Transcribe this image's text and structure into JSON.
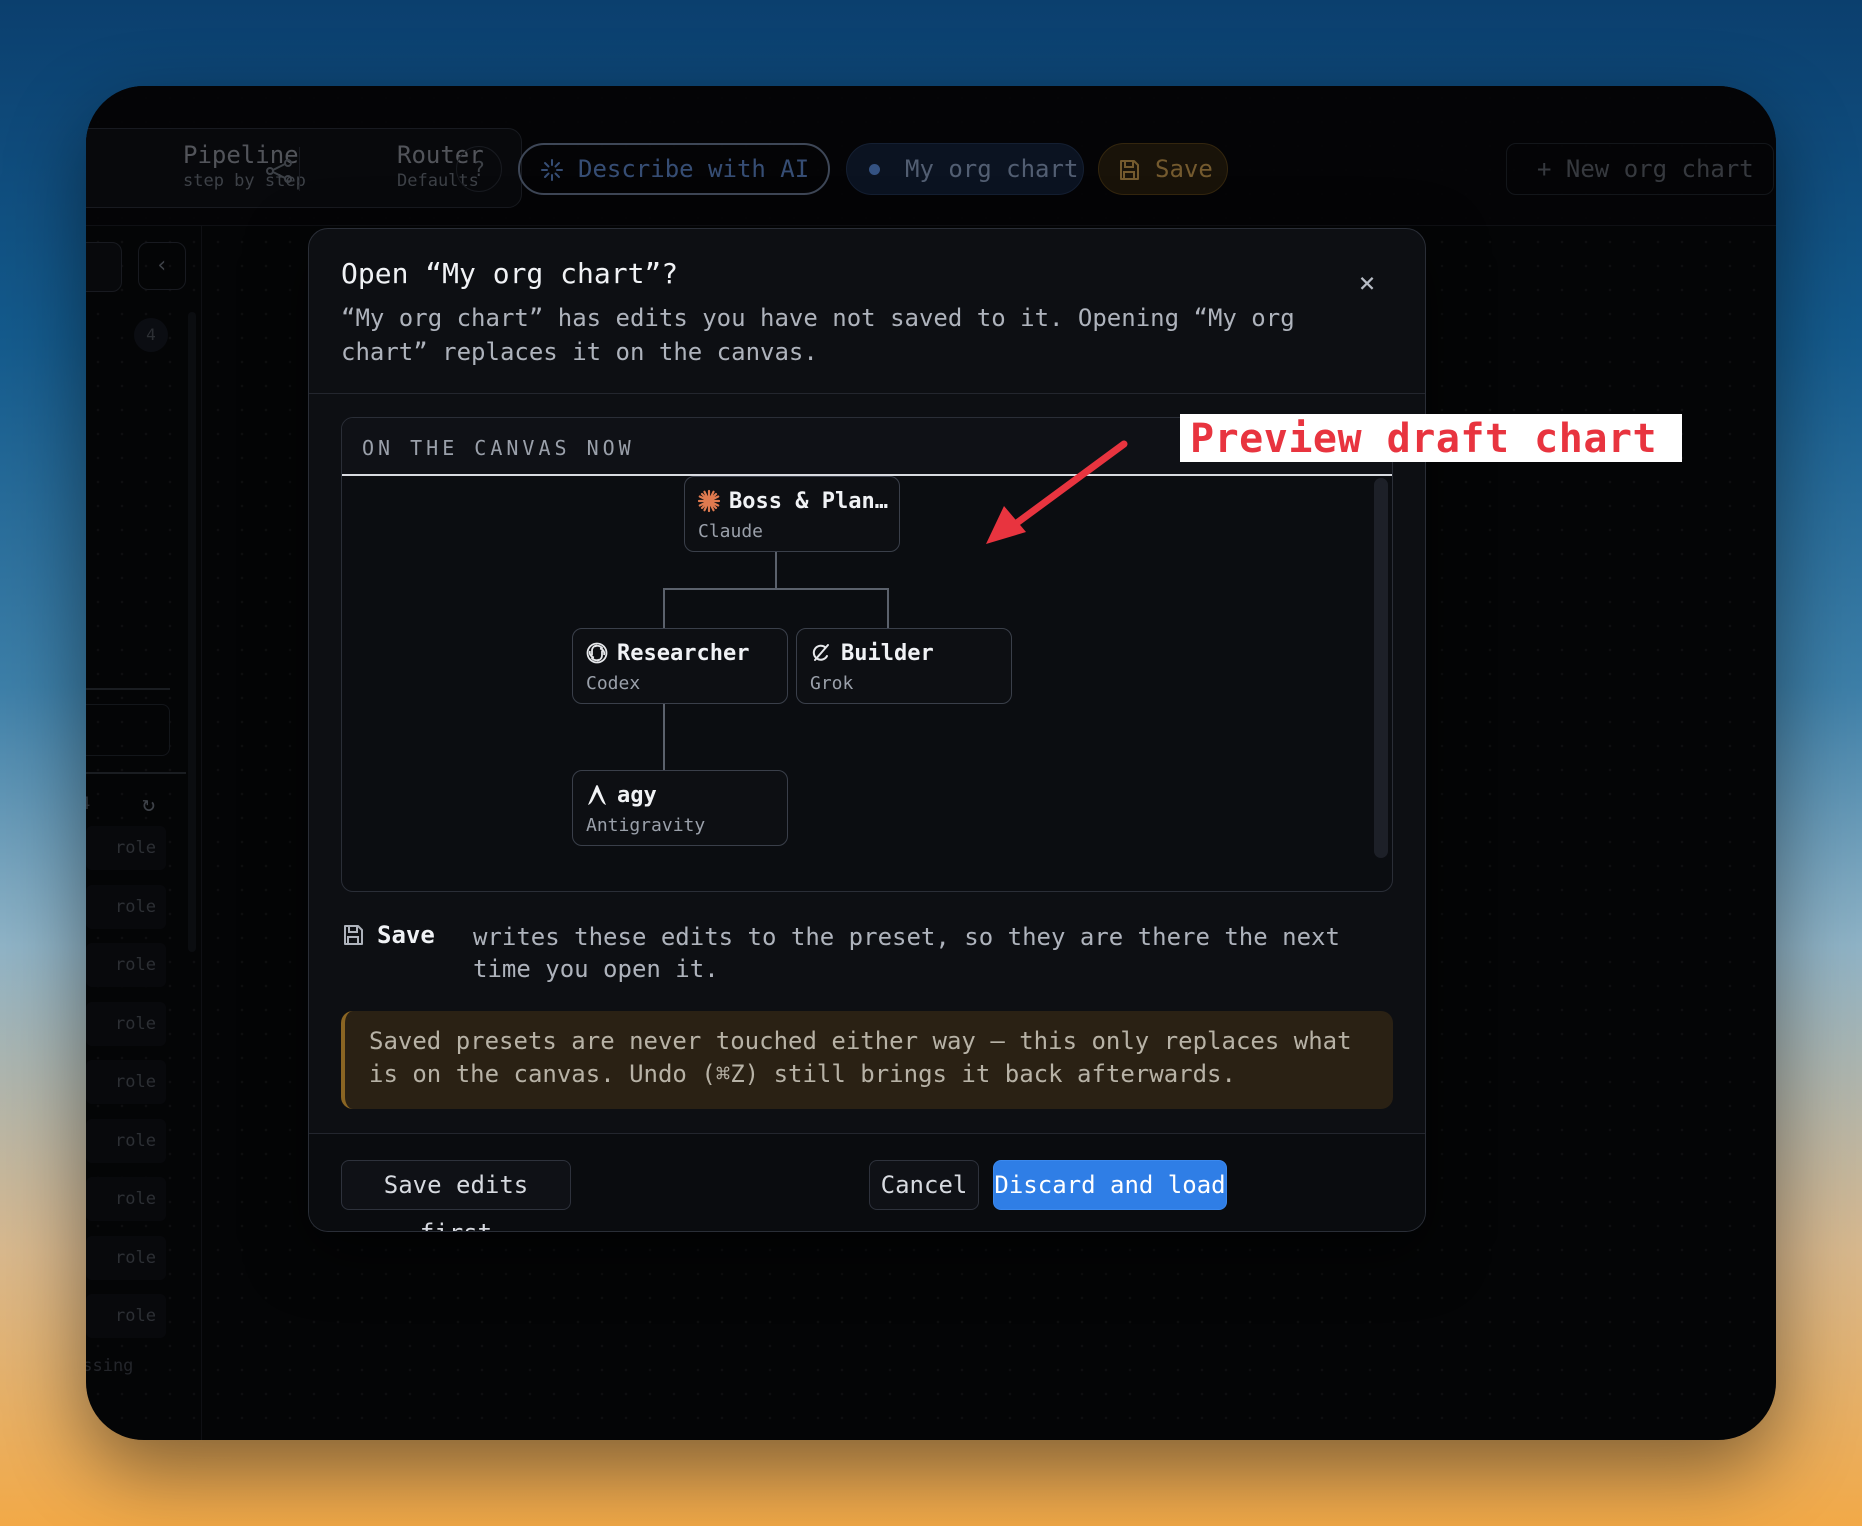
{
  "toolbar": {
    "pipeline_title": "Pipeline",
    "pipeline_sub": "step by step",
    "router_title": "Router",
    "router_sub": "Defaults",
    "help_label": "?",
    "describe_ai_label": "Describe with AI",
    "chart_name": "My org chart",
    "save_label": "Save",
    "new_chart_label": "+ New org chart"
  },
  "sidebar": {
    "badge": "4",
    "chevron": "‹",
    "count": "4",
    "refresh_icon": "↻",
    "roles": [
      "role",
      "role",
      "role",
      "role",
      "role",
      "role",
      "role",
      "role",
      "role"
    ],
    "missing": "issing"
  },
  "modal": {
    "title": "Open “My org chart”?",
    "close": "×",
    "description": "“My org chart” has edits you have not saved to it. Opening “My org chart” replaces it on the canvas.",
    "preview_label": "ON THE CANVAS NOW",
    "nodes": [
      {
        "name": "Boss & Plan…",
        "provider": "Claude",
        "icon": "claude-icon"
      },
      {
        "name": "Researcher",
        "provider": "Codex",
        "icon": "openai-icon"
      },
      {
        "name": "Builder",
        "provider": "Grok",
        "icon": "grok-icon"
      },
      {
        "name": "agy",
        "provider": "Antigravity",
        "icon": "antigravity-icon"
      }
    ],
    "save_note_keyword": "Save",
    "save_note_text": "writes these edits to the preset, so they are there the next time you open it.",
    "warning": "Saved presets are never touched either way — this only replaces what is on the canvas. Undo (⌘Z) still brings it back afterwards.",
    "buttons": {
      "save_first": "Save edits first",
      "cancel": "Cancel",
      "discard": "Discard and load"
    }
  },
  "annotation": {
    "label": "Preview draft chart",
    "color": "#e8343f"
  },
  "colors": {
    "accent": "#2f7ee6",
    "save_accent": "#c89b50",
    "claude": "#e07a4f"
  }
}
